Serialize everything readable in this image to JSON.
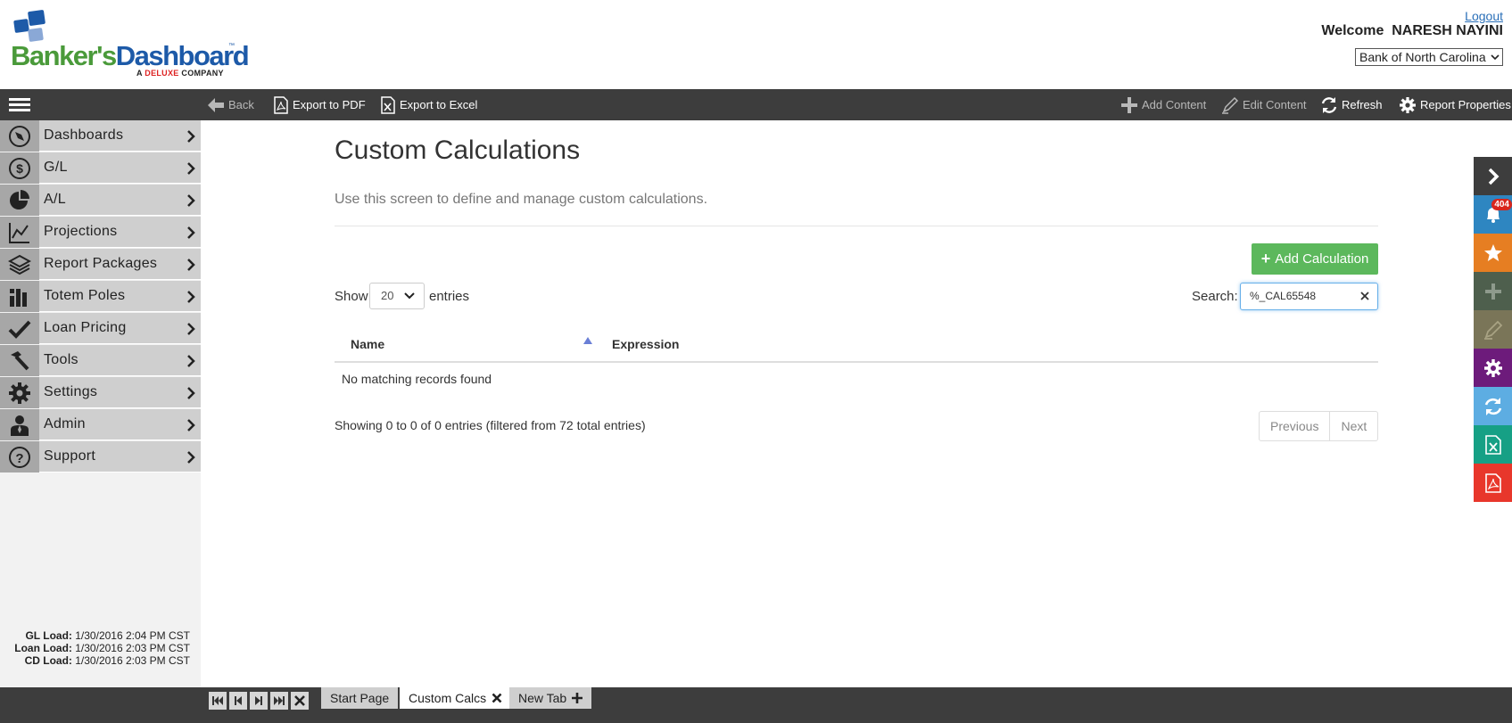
{
  "header": {
    "logo": {
      "name_part1": "Banker's",
      "name_part2": "Dashboard",
      "tm": "™",
      "sub_prefix": "A",
      "sub_brand": "DELUXE",
      "sub_suffix": "COMPANY",
      "colors": {
        "green": "#4a9a3a",
        "blue": "#1d5aa8",
        "red": "#d22222"
      }
    },
    "logout_label": "Logout",
    "welcome_label": "Welcome",
    "user_name": "NARESH NAYINI",
    "bank_selected": "Bank of North Carolina"
  },
  "toolbar": {
    "back_label": "Back",
    "export_pdf_label": "Export to PDF",
    "export_excel_label": "Export to Excel",
    "add_content_label": "Add Content",
    "edit_content_label": "Edit Content",
    "refresh_label": "Refresh",
    "report_properties_label": "Report Properties"
  },
  "sidebar": {
    "items": [
      {
        "label": "Dashboards",
        "icon": "compass-icon"
      },
      {
        "label": "G/L",
        "icon": "dollar-icon"
      },
      {
        "label": "A/L",
        "icon": "pie-icon"
      },
      {
        "label": "Projections",
        "icon": "line-chart-icon"
      },
      {
        "label": "Report Packages",
        "icon": "layers-icon"
      },
      {
        "label": "Totem Poles",
        "icon": "bars-icon"
      },
      {
        "label": "Loan Pricing",
        "icon": "check-icon"
      },
      {
        "label": "Tools",
        "icon": "hammer-icon"
      },
      {
        "label": "Settings",
        "icon": "gear-icon"
      },
      {
        "label": "Admin",
        "icon": "user-icon"
      },
      {
        "label": "Support",
        "icon": "help-icon"
      }
    ],
    "loads": [
      {
        "label": "GL Load:",
        "value": "1/30/2016 2:04 PM CST"
      },
      {
        "label": "Loan Load:",
        "value": "1/30/2016 2:03 PM CST"
      },
      {
        "label": "CD Load:",
        "value": "1/30/2016 2:03 PM CST"
      }
    ]
  },
  "main": {
    "title": "Custom Calculations",
    "description": "Use this screen to define and manage custom calculations.",
    "add_button_label": "Add Calculation",
    "show_label": "Show",
    "page_length": "20",
    "entries_label": "entries",
    "search_label": "Search:",
    "search_value": "%_CAL65548",
    "table": {
      "columns": [
        "Name",
        "Expression"
      ],
      "empty_message": "No matching records found"
    },
    "info": "Showing 0 to 0 of 0 entries (filtered from 72 total entries)",
    "prev_label": "Previous",
    "next_label": "Next"
  },
  "quickbar": {
    "notifications_count": "404",
    "colors": [
      "#3d3d3d",
      "#2e86c1",
      "#e67e22",
      "#4e5f4d",
      "#7a7558",
      "#6d1b7b",
      "#5dade2",
      "#16a085",
      "#e8372b"
    ]
  },
  "tabs": {
    "items": [
      {
        "label": "Start Page"
      },
      {
        "label": "Custom Calcs"
      },
      {
        "label": "New Tab"
      }
    ]
  }
}
